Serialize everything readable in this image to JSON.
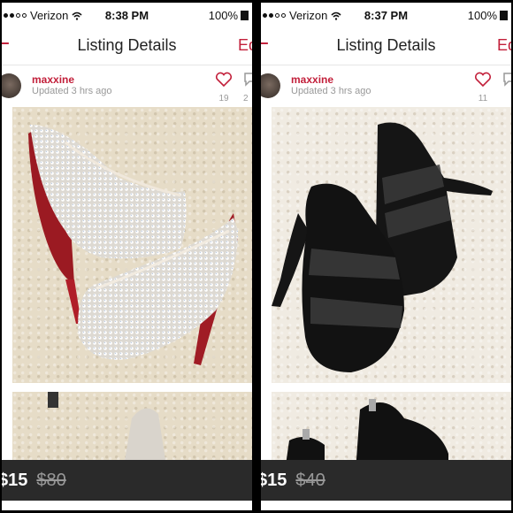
{
  "left": {
    "status": {
      "carrier": "Verizon",
      "time": "8:38 PM",
      "battery": "100%"
    },
    "nav": {
      "back": "−",
      "title": "Listing Details",
      "edit": "Ed"
    },
    "user": {
      "name": "maxxine",
      "updated": "Updated 3 hrs ago"
    },
    "likes": "19",
    "comments": "2",
    "price": {
      "current": "$15",
      "original": "$80"
    }
  },
  "right": {
    "status": {
      "carrier": "Verizon",
      "time": "8:37 PM",
      "battery": "100%"
    },
    "nav": {
      "back": "−",
      "title": "Listing Details",
      "edit": "Ed"
    },
    "user": {
      "name": "maxxine",
      "updated": "Updated 3 hrs ago"
    },
    "likes": "11",
    "comments": "",
    "price": {
      "current": "$15",
      "original": "$40"
    }
  },
  "colors": {
    "accent": "#c21f3a",
    "price_bar": "#2a2a2a"
  },
  "icons": [
    "signal-dots-icon",
    "wifi-icon",
    "battery-icon",
    "heart-icon",
    "comment-icon"
  ]
}
